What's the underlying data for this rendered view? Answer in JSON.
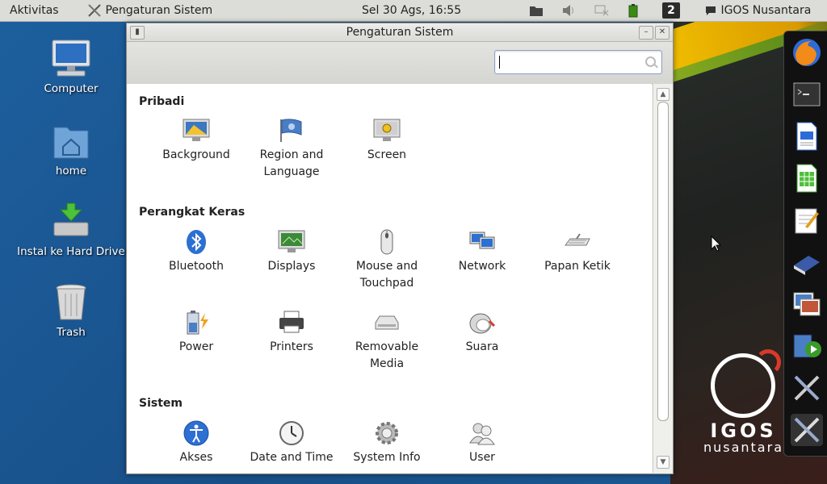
{
  "topbar": {
    "activities": "Aktivitas",
    "app_name": "Pengaturan Sistem",
    "clock": "Sel 30 Ags, 16:55",
    "workspace": "2",
    "user": "IGOS Nusantara"
  },
  "desktop": {
    "icons": [
      {
        "label": "Computer"
      },
      {
        "label": "home"
      },
      {
        "label": "Instal ke Hard Drive"
      },
      {
        "label": "Trash"
      }
    ],
    "brand_line1": "IGOS",
    "brand_line2": "nusantara"
  },
  "window": {
    "title": "Pengaturan Sistem",
    "search_placeholder": "",
    "sections": [
      {
        "title": "Pribadi",
        "items": [
          {
            "label": "Background",
            "icon": "monitor-background-icon"
          },
          {
            "label": "Region and Language",
            "icon": "flag-icon"
          },
          {
            "label": "Screen",
            "icon": "screen-icon"
          }
        ]
      },
      {
        "title": "Perangkat Keras",
        "items": [
          {
            "label": "Bluetooth",
            "icon": "bluetooth-icon"
          },
          {
            "label": "Displays",
            "icon": "displays-icon"
          },
          {
            "label": "Mouse and Touchpad",
            "icon": "mouse-icon"
          },
          {
            "label": "Network",
            "icon": "network-icon"
          },
          {
            "label": "Papan Ketik",
            "icon": "keyboard-icon"
          },
          {
            "label": "Power",
            "icon": "battery-icon"
          },
          {
            "label": "Printers",
            "icon": "printer-icon"
          },
          {
            "label": "Removable Media",
            "icon": "drive-icon"
          },
          {
            "label": "Suara",
            "icon": "speaker-icon"
          }
        ]
      },
      {
        "title": "Sistem",
        "items": [
          {
            "label": "Akses",
            "icon": "accessibility-icon"
          },
          {
            "label": "Date and Time",
            "icon": "clock-icon"
          },
          {
            "label": "System Info",
            "icon": "gear-icon"
          },
          {
            "label": "User",
            "icon": "users-icon"
          }
        ]
      }
    ]
  },
  "dock": [
    "firefox-icon",
    "terminal-icon",
    "writer-icon",
    "calc-icon",
    "text-editor-icon",
    "book-icon",
    "image-viewer-icon",
    "video-player-icon",
    "settings-tools-icon",
    "settings-tools-icon"
  ]
}
